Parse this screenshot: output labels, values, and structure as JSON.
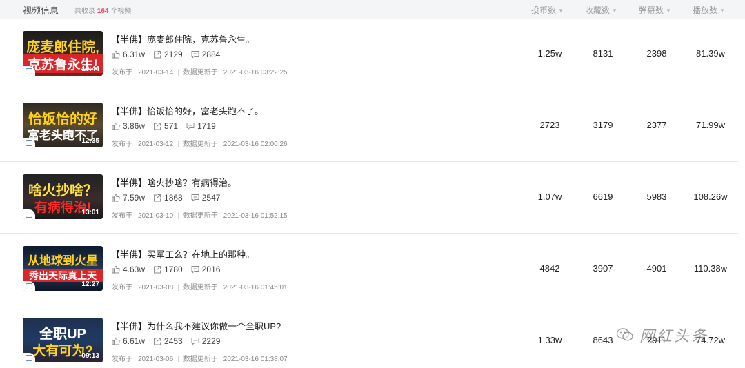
{
  "header": {
    "title": "视频信息",
    "count_prefix": "共收录",
    "count_value": "164",
    "count_suffix": "个视频",
    "columns": [
      "投币数",
      "收藏数",
      "弹幕数",
      "播放数"
    ]
  },
  "videos": [
    {
      "thumb_line1": "庞麦郎住院,",
      "thumb_line2": "克苏鲁永生!",
      "duration": "10:44",
      "title": "【半佛】庞麦郎住院，克苏鲁永生。",
      "likes": "6.31w",
      "shares": "2129",
      "comments": "2884",
      "published_label": "发布于",
      "published": "2021-03-14",
      "updated_label": "数据更新于",
      "updated": "2021-03-16 03:22:25",
      "coins": "1.25w",
      "favorites": "8131",
      "danmaku": "2398",
      "plays": "81.39w"
    },
    {
      "thumb_line1": "恰饭恰的好",
      "thumb_line2": "富老头跑不了",
      "duration": "12:35",
      "title": "【半佛】恰饭恰的好，富老头跑不了。",
      "likes": "3.86w",
      "shares": "571",
      "comments": "1719",
      "published_label": "发布于",
      "published": "2021-03-12",
      "updated_label": "数据更新于",
      "updated": "2021-03-16 02:00:26",
      "coins": "2723",
      "favorites": "3179",
      "danmaku": "2377",
      "plays": "71.99w"
    },
    {
      "thumb_line1": "啥火抄啥？",
      "thumb_line2": "有病得治!",
      "duration": "13:01",
      "title": "【半佛】啥火抄啥？有病得治。",
      "likes": "7.59w",
      "shares": "1868",
      "comments": "2547",
      "published_label": "发布于",
      "published": "2021-03-10",
      "updated_label": "数据更新于",
      "updated": "2021-03-16 01:52:15",
      "coins": "1.07w",
      "favorites": "6619",
      "danmaku": "5983",
      "plays": "108.26w"
    },
    {
      "thumb_line1": "从地球到火星",
      "thumb_line2": "秀出天际真上天",
      "duration": "12:27",
      "title": "【半佛】买军工么？在地上的那种。",
      "likes": "4.63w",
      "shares": "1780",
      "comments": "2016",
      "published_label": "发布于",
      "published": "2021-03-08",
      "updated_label": "数据更新于",
      "updated": "2021-03-16 01:45:01",
      "coins": "4842",
      "favorites": "3907",
      "danmaku": "4901",
      "plays": "110.38w"
    },
    {
      "thumb_line1": "全职UP",
      "thumb_line2": "大有可为?",
      "duration": "09:13",
      "title": "【半佛】为什么我不建议你做一个全职UP?",
      "likes": "6.61w",
      "shares": "2453",
      "comments": "2229",
      "published_label": "发布于",
      "published": "2021-03-06",
      "updated_label": "数据更新于",
      "updated": "2021-03-16 01:38:07",
      "coins": "1.33w",
      "favorites": "8643",
      "danmaku": "2911",
      "plays": "74.72w"
    }
  ],
  "watermark": {
    "text": "网红头条",
    "icon": "wechat-icon"
  }
}
